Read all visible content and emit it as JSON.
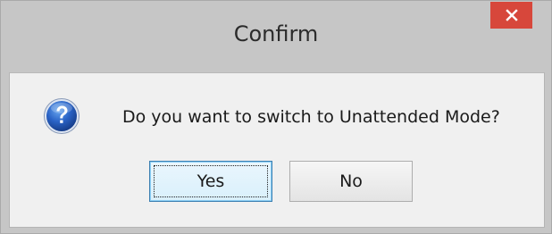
{
  "window": {
    "title": "Confirm"
  },
  "titlebar": {
    "close_icon": "close-icon"
  },
  "dialog": {
    "icon": "question-icon",
    "message": "Do you want to switch to Unattended Mode?",
    "yes_label": "Yes",
    "no_label": "No"
  },
  "colors": {
    "frame": "#c6c6c6",
    "client": "#f0f0f0",
    "close_button": "#d7473b",
    "focus_border": "#3c7fb1",
    "icon_blue": "#2a63c6"
  }
}
